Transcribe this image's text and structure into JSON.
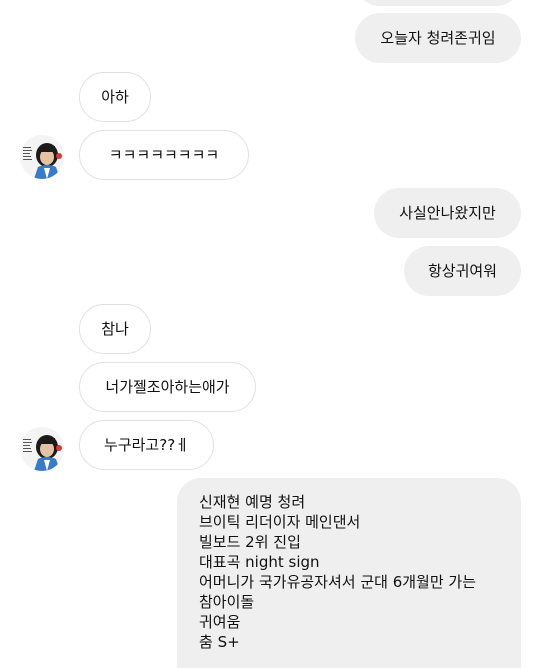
{
  "messages": {
    "top_partial": "",
    "m1": "오늘자 청려존귀임",
    "m2": "아하",
    "m3": "ㅋㅋㅋㅋㅋㅋㅋㅋ",
    "m4": "사실안나왔지만",
    "m5": "항상귀여워",
    "m6": "참나",
    "m7": "너가젤조아하는애가",
    "m8": "누구라고??ㅔ",
    "m9_lines": [
      "신재현 예명 청려",
      "브이틱 리더이자 메인댄서",
      "빌보드 2위 진입",
      "대표곡 night sign",
      "어머니가 국가유공자셔서 군대 6개월만 가는",
      "참아이돌",
      "귀여움",
      "춤 S+"
    ]
  },
  "colors": {
    "incoming_bg": "#ffffff",
    "incoming_border": "#e2e2e2",
    "outgoing_bg": "#efefef",
    "text": "#111111"
  },
  "avatar": {
    "name": "profile-avatar"
  }
}
